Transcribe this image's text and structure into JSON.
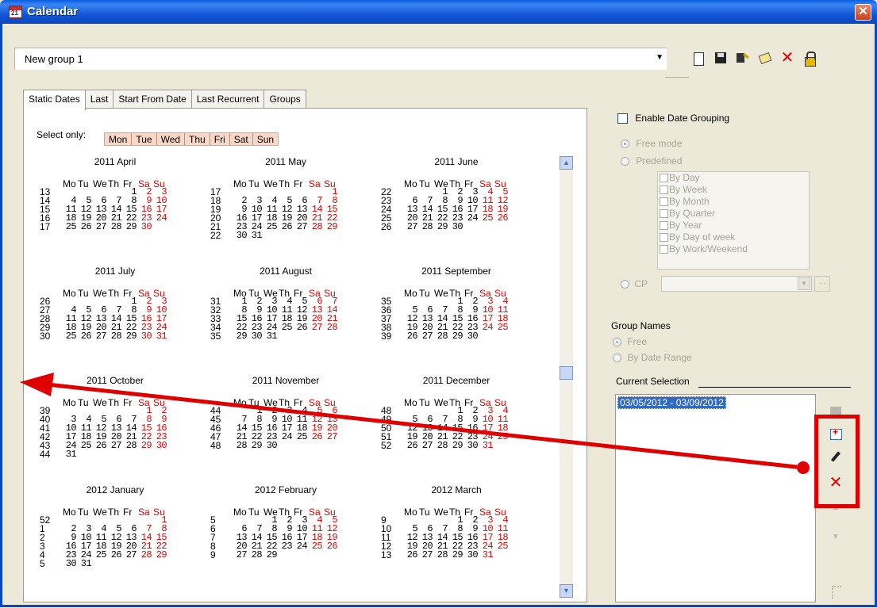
{
  "window": {
    "title": "Calendar",
    "close_label": "✕"
  },
  "group": {
    "name": "New group 1",
    "dropdown_arrow": "▼"
  },
  "toolbar": {
    "icons": [
      "new-icon",
      "save-icon",
      "edit-icon",
      "copy-icon",
      "delete-icon",
      "lock-icon"
    ],
    "delete_glyph": "✕"
  },
  "tabs": [
    "Static Dates",
    "Last",
    "Start From Date",
    "Last Recurrent",
    "Groups"
  ],
  "select_only": {
    "label": "Select only:",
    "days": [
      "Mon",
      "Tue",
      "Wed",
      "Thu",
      "Fri",
      "Sat",
      "Sun"
    ]
  },
  "weekday_header": [
    "Mo",
    "Tu",
    "We",
    "Th",
    "Fr",
    "Sa",
    "Su"
  ],
  "months": [
    {
      "title": "2011 April",
      "weeks": [
        "13",
        "14",
        "15",
        "16",
        "17"
      ],
      "rows": [
        [
          "",
          "",
          "",
          "",
          "1",
          "2",
          "3"
        ],
        [
          "4",
          "5",
          "6",
          "7",
          "8",
          "9",
          "10"
        ],
        [
          "11",
          "12",
          "13",
          "14",
          "15",
          "16",
          "17"
        ],
        [
          "18",
          "19",
          "20",
          "21",
          "22",
          "23",
          "24"
        ],
        [
          "25",
          "26",
          "27",
          "28",
          "29",
          "30",
          ""
        ]
      ]
    },
    {
      "title": "2011 May",
      "weeks": [
        "17",
        "18",
        "19",
        "20",
        "21",
        "22"
      ],
      "rows": [
        [
          "",
          "",
          "",
          "",
          "",
          "",
          "1"
        ],
        [
          "2",
          "3",
          "4",
          "5",
          "6",
          "7",
          "8"
        ],
        [
          "9",
          "10",
          "11",
          "12",
          "13",
          "14",
          "15"
        ],
        [
          "16",
          "17",
          "18",
          "19",
          "20",
          "21",
          "22"
        ],
        [
          "23",
          "24",
          "25",
          "26",
          "27",
          "28",
          "29"
        ],
        [
          "30",
          "31",
          "",
          "",
          "",
          "",
          ""
        ]
      ]
    },
    {
      "title": "2011 June",
      "weeks": [
        "22",
        "23",
        "24",
        "25",
        "26"
      ],
      "rows": [
        [
          "",
          "",
          "1",
          "2",
          "3",
          "4",
          "5"
        ],
        [
          "6",
          "7",
          "8",
          "9",
          "10",
          "11",
          "12"
        ],
        [
          "13",
          "14",
          "15",
          "16",
          "17",
          "18",
          "19"
        ],
        [
          "20",
          "21",
          "22",
          "23",
          "24",
          "25",
          "26"
        ],
        [
          "27",
          "28",
          "29",
          "30",
          "",
          "",
          ""
        ]
      ]
    },
    {
      "title": "2011 July",
      "weeks": [
        "26",
        "27",
        "28",
        "29",
        "30"
      ],
      "rows": [
        [
          "",
          "",
          "",
          "",
          "1",
          "2",
          "3"
        ],
        [
          "4",
          "5",
          "6",
          "7",
          "8",
          "9",
          "10"
        ],
        [
          "11",
          "12",
          "13",
          "14",
          "15",
          "16",
          "17"
        ],
        [
          "18",
          "19",
          "20",
          "21",
          "22",
          "23",
          "24"
        ],
        [
          "25",
          "26",
          "27",
          "28",
          "29",
          "30",
          "31"
        ]
      ]
    },
    {
      "title": "2011 August",
      "weeks": [
        "31",
        "32",
        "33",
        "34",
        "35"
      ],
      "rows": [
        [
          "1",
          "2",
          "3",
          "4",
          "5",
          "6",
          "7"
        ],
        [
          "8",
          "9",
          "10",
          "11",
          "12",
          "13",
          "14"
        ],
        [
          "15",
          "16",
          "17",
          "18",
          "19",
          "20",
          "21"
        ],
        [
          "22",
          "23",
          "24",
          "25",
          "26",
          "27",
          "28"
        ],
        [
          "29",
          "30",
          "31",
          "",
          "",
          "",
          ""
        ]
      ]
    },
    {
      "title": "2011 September",
      "weeks": [
        "35",
        "36",
        "37",
        "38",
        "39"
      ],
      "rows": [
        [
          "",
          "",
          "",
          "1",
          "2",
          "3",
          "4"
        ],
        [
          "5",
          "6",
          "7",
          "8",
          "9",
          "10",
          "11"
        ],
        [
          "12",
          "13",
          "14",
          "15",
          "16",
          "17",
          "18"
        ],
        [
          "19",
          "20",
          "21",
          "22",
          "23",
          "24",
          "25"
        ],
        [
          "26",
          "27",
          "28",
          "29",
          "30",
          "",
          ""
        ]
      ]
    },
    {
      "title": "2011 October",
      "weeks": [
        "39",
        "40",
        "41",
        "42",
        "43",
        "44"
      ],
      "rows": [
        [
          "",
          "",
          "",
          "",
          "",
          "1",
          "2"
        ],
        [
          "3",
          "4",
          "5",
          "6",
          "7",
          "8",
          "9"
        ],
        [
          "10",
          "11",
          "12",
          "13",
          "14",
          "15",
          "16"
        ],
        [
          "17",
          "18",
          "19",
          "20",
          "21",
          "22",
          "23"
        ],
        [
          "24",
          "25",
          "26",
          "27",
          "28",
          "29",
          "30"
        ],
        [
          "31",
          "",
          "",
          "",
          "",
          "",
          ""
        ]
      ]
    },
    {
      "title": "2011 November",
      "weeks": [
        "44",
        "45",
        "46",
        "47",
        "48"
      ],
      "rows": [
        [
          "",
          "1",
          "2",
          "3",
          "4",
          "5",
          "6"
        ],
        [
          "7",
          "8",
          "9",
          "10",
          "11",
          "12",
          "13"
        ],
        [
          "14",
          "15",
          "16",
          "17",
          "18",
          "19",
          "20"
        ],
        [
          "21",
          "22",
          "23",
          "24",
          "25",
          "26",
          "27"
        ],
        [
          "28",
          "29",
          "30",
          "",
          "",
          "",
          ""
        ]
      ]
    },
    {
      "title": "2011 December",
      "weeks": [
        "48",
        "49",
        "50",
        "51",
        "52"
      ],
      "rows": [
        [
          "",
          "",
          "",
          "1",
          "2",
          "3",
          "4"
        ],
        [
          "5",
          "6",
          "7",
          "8",
          "9",
          "10",
          "11"
        ],
        [
          "12",
          "13",
          "14",
          "15",
          "16",
          "17",
          "18"
        ],
        [
          "19",
          "20",
          "21",
          "22",
          "23",
          "24",
          "25"
        ],
        [
          "26",
          "27",
          "28",
          "29",
          "30",
          "31",
          ""
        ]
      ]
    },
    {
      "title": "2012 January",
      "weeks": [
        "52",
        "1",
        "2",
        "3",
        "4",
        "5"
      ],
      "rows": [
        [
          "",
          "",
          "",
          "",
          "",
          "",
          "1"
        ],
        [
          "2",
          "3",
          "4",
          "5",
          "6",
          "7",
          "8"
        ],
        [
          "9",
          "10",
          "11",
          "12",
          "13",
          "14",
          "15"
        ],
        [
          "16",
          "17",
          "18",
          "19",
          "20",
          "21",
          "22"
        ],
        [
          "23",
          "24",
          "25",
          "26",
          "27",
          "28",
          "29"
        ],
        [
          "30",
          "31",
          "",
          "",
          "",
          "",
          ""
        ]
      ]
    },
    {
      "title": "2012 February",
      "weeks": [
        "5",
        "6",
        "7",
        "8",
        "9"
      ],
      "rows": [
        [
          "",
          "",
          "1",
          "2",
          "3",
          "4",
          "5"
        ],
        [
          "6",
          "7",
          "8",
          "9",
          "10",
          "11",
          "12"
        ],
        [
          "13",
          "14",
          "15",
          "16",
          "17",
          "18",
          "19"
        ],
        [
          "20",
          "21",
          "22",
          "23",
          "24",
          "25",
          "26"
        ],
        [
          "27",
          "28",
          "29",
          "",
          "",
          "",
          ""
        ]
      ]
    },
    {
      "title": "2012 March",
      "weeks": [
        "9",
        "10",
        "11",
        "12",
        "13"
      ],
      "rows": [
        [
          "",
          "",
          "",
          "1",
          "2",
          "3",
          "4"
        ],
        [
          "5",
          "6",
          "7",
          "8",
          "9",
          "10",
          "11"
        ],
        [
          "12",
          "13",
          "14",
          "15",
          "16",
          "17",
          "18"
        ],
        [
          "19",
          "20",
          "21",
          "22",
          "23",
          "24",
          "25"
        ],
        [
          "26",
          "27",
          "28",
          "29",
          "30",
          "31",
          ""
        ]
      ]
    }
  ],
  "right_panel": {
    "enable_grouping": "Enable Date Grouping",
    "free_mode": "Free mode",
    "predefined": "Predefined",
    "predefined_items": [
      "By Day",
      "By Week",
      "By Month",
      "By Quarter",
      "By Year",
      "By Day of week",
      "By Work/Weekend"
    ],
    "cp_label": "CP",
    "cp_button": "...",
    "group_names": "Group Names",
    "gn_free": "Free",
    "gn_range": "By Date Range",
    "current_selection": "Current Selection",
    "selection_items": [
      "03/05/2012 - 03/09/2012"
    ]
  },
  "side_icons": [
    "folder-icon",
    "add-icon",
    "edit-icon",
    "remove-icon",
    "move-up-icon",
    "move-down-icon",
    "tree-icon"
  ],
  "colors": {
    "weekend": "#e00000",
    "annotation": "#e00000",
    "title_bar": "#0a5fe0",
    "selection": "#316ac5"
  }
}
